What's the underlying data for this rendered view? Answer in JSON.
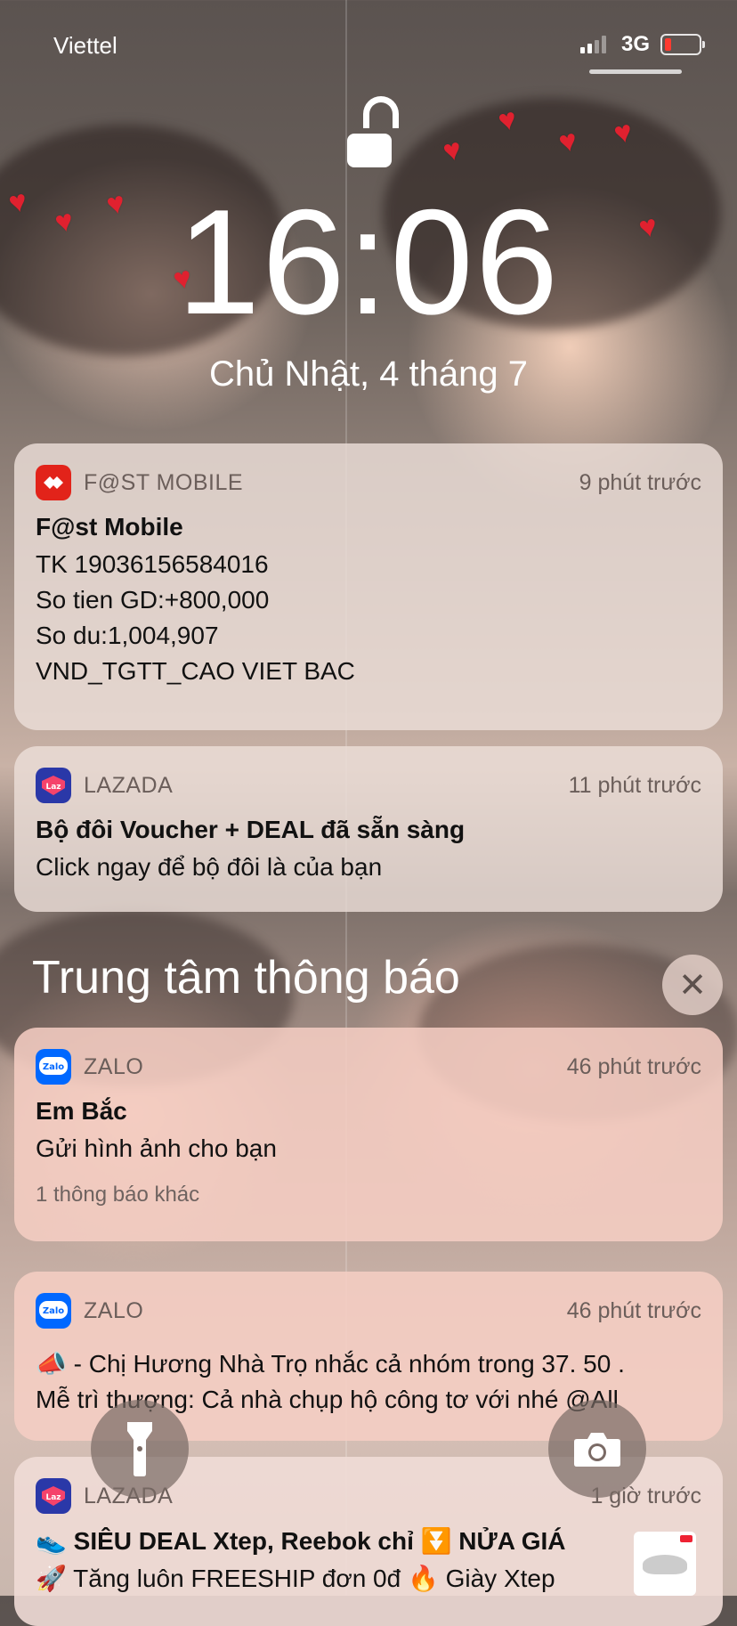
{
  "status_bar": {
    "carrier": "Viettel",
    "network": "3G",
    "battery_color": "#ff3b30"
  },
  "lock": {
    "time": "16:06",
    "date": "Chủ Nhật, 4 tháng 7"
  },
  "notifications": [
    {
      "app": "F@ST MOBILE",
      "icon": "techcombank-icon",
      "age": "9 phút trước",
      "title": "F@st Mobile",
      "lines": [
        "TK 19036156584016",
        "So tien GD:+800,000",
        "So du:1,004,907",
        "VND_TGTT_CAO VIET BAC"
      ]
    },
    {
      "app": "LAZADA",
      "icon": "lazada-icon",
      "age": "11 phút trước",
      "title": "Bộ đôi Voucher + DEAL đã sẵn sàng",
      "lines": [
        "Click ngay để bộ đôi là của bạn"
      ]
    }
  ],
  "center": {
    "title": "Trung tâm thông báo",
    "items": [
      {
        "app": "ZALO",
        "icon": "zalo-icon",
        "age": "46 phút trước",
        "title": "Em Bắc",
        "lines": [
          "Gửi hình ảnh cho bạn"
        ],
        "more": "1 thông báo khác"
      },
      {
        "app": "ZALO",
        "icon": "zalo-icon",
        "age": "46 phút trước",
        "lines": [
          "📣 - Chị Hương Nhà Trọ nhắc cả nhóm trong 37. 50 .",
          "Mễ trì thượng: Cả nhà chụp hộ công tơ với nhé @All"
        ]
      },
      {
        "app": "LAZADA",
        "icon": "lazada-icon",
        "age": "1 giờ trước",
        "title": "👟 SIÊU DEAL Xtep, Reebok chỉ ⏬ NỬA GIÁ",
        "lines": [
          "🚀 Tăng luôn FREESHIP đơn 0đ 🔥 Giày Xtep"
        ]
      }
    ]
  },
  "buttons": {
    "flashlight": "flashlight-icon",
    "camera": "camera-icon"
  },
  "colors": {
    "techcombank": "#e2231a",
    "lazada": "#2a38a8",
    "zalo": "#0068ff"
  }
}
